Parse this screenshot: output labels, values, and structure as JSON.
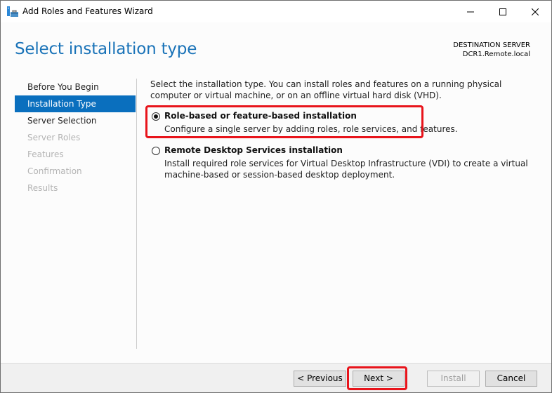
{
  "window": {
    "title": "Add Roles and Features Wizard",
    "icon": "server-manager-icon",
    "controls": {
      "minimize": "minimize-icon",
      "maximize": "maximize-icon",
      "close": "close-icon"
    }
  },
  "header": {
    "page_title": "Select installation type",
    "destination_label": "DESTINATION SERVER",
    "destination_server": "DCR1.Remote.local"
  },
  "nav": {
    "items": [
      {
        "label": "Before You Begin",
        "state": "enabled"
      },
      {
        "label": "Installation Type",
        "state": "active"
      },
      {
        "label": "Server Selection",
        "state": "enabled"
      },
      {
        "label": "Server Roles",
        "state": "disabled"
      },
      {
        "label": "Features",
        "state": "disabled"
      },
      {
        "label": "Confirmation",
        "state": "disabled"
      },
      {
        "label": "Results",
        "state": "disabled"
      }
    ]
  },
  "content": {
    "intro": "Select the installation type. You can install roles and features on a running physical computer or virtual machine, or on an offline virtual hard disk (VHD).",
    "options": [
      {
        "label": "Role-based or feature-based installation",
        "description": "Configure a single server by adding roles, role services, and features.",
        "selected": true
      },
      {
        "label": "Remote Desktop Services installation",
        "description": "Install required role services for Virtual Desktop Infrastructure (VDI) to create a virtual machine-based or session-based desktop deployment.",
        "selected": false
      }
    ]
  },
  "footer": {
    "previous_label": "< Previous",
    "next_label": "Next >",
    "install_label": "Install",
    "install_enabled": false,
    "cancel_label": "Cancel"
  },
  "colors": {
    "accent": "#0a6fbe",
    "title": "#1a73b8",
    "highlight": "#e8141b",
    "disabled_text": "#b4b4b4"
  }
}
